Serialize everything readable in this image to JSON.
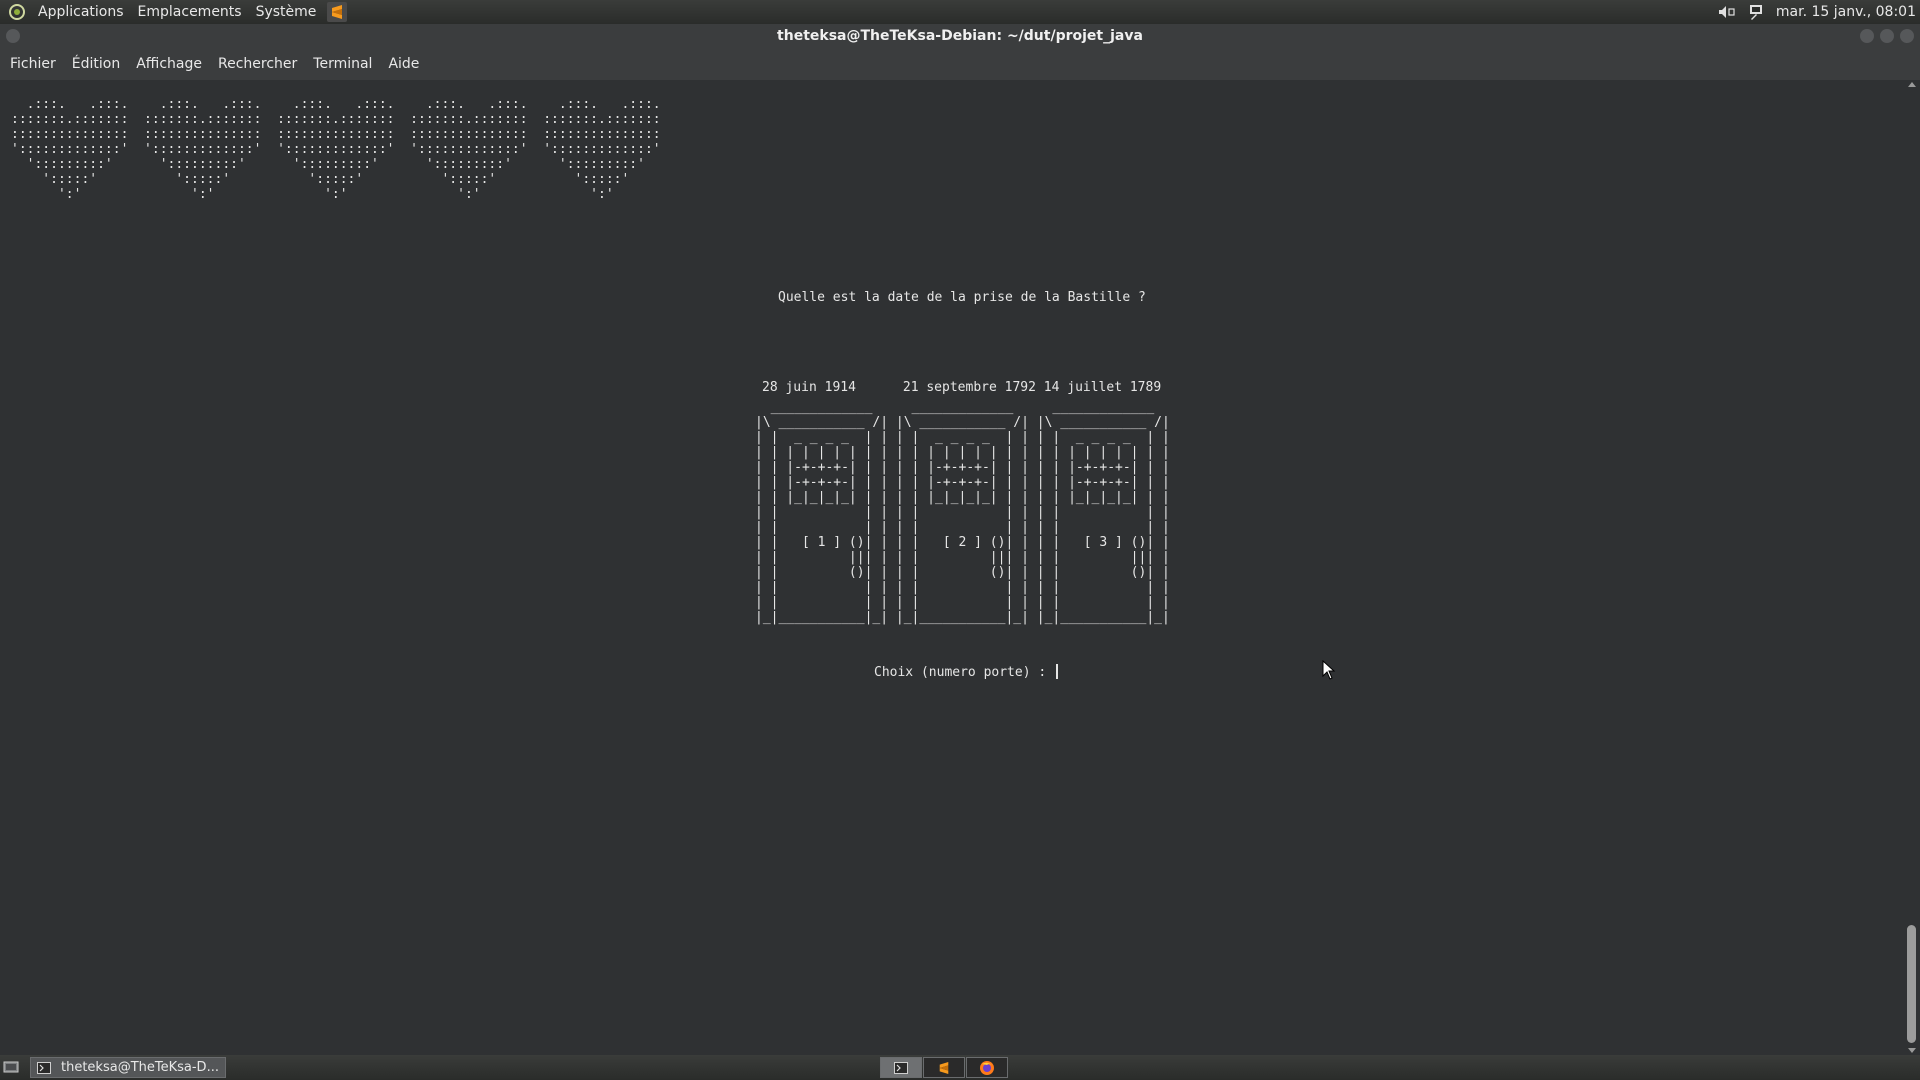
{
  "top_panel": {
    "menus": [
      "Applications",
      "Emplacements",
      "Système"
    ],
    "launcher_icon": "sublime-text-icon",
    "tray": {
      "volume_icon": "volume-icon",
      "network_icon": "network-icon"
    },
    "clock": "mar. 15 janv., 08:01"
  },
  "window": {
    "title": "theteksa@TheTeKsa-Debian: ~/dut/projet_java"
  },
  "menubar": {
    "items": [
      "Fichier",
      "Édition",
      "Affichage",
      "Rechercher",
      "Terminal",
      "Aide"
    ]
  },
  "terminal": {
    "hearts_art": "  .:::.   .:::.    .:::.   .:::.    .:::.   .:::.    .:::.   .:::.    .:::.   .:::.\n:::::::.:::::::  :::::::.:::::::  :::::::.:::::::  :::::::.:::::::  :::::::.:::::::\n:::::::::::::::  :::::::::::::::  :::::::::::::::  :::::::::::::::  :::::::::::::::\n':::::::::::::'  ':::::::::::::'  ':::::::::::::'  ':::::::::::::'  ':::::::::::::'\n  ':::::::::'      ':::::::::'      ':::::::::'      ':::::::::'      ':::::::::'\n    ':::::'          ':::::'          ':::::'          ':::::'          ':::::'\n      ':'              ':'              ':'              ':'              ':'",
    "question": "Quelle est la date de la prise de la Bastille ?",
    "answers_line": "28 juin 1914      21 septembre 1792 14 juillet 1789",
    "doors_art": "  _____________     _____________     _____________\n|\\ ___________ /| |\\ ___________ /| |\\ ___________ /|\n| |  _ _ _ _  | | | |  _ _ _ _  | | | |  _ _ _ _  | |\n| | | | | | | | | | | | | | | | | | | | | | | | | | |\n| | |-+-+-+-| | | | | |-+-+-+-| | | | | |-+-+-+-| | |\n| | |-+-+-+-| | | | | |-+-+-+-| | | | | |-+-+-+-| | |\n| | |_|_|_|_| | | | | |_|_|_|_| | | | | |_|_|_|_| | |\n| |           | | | |           | | | |           | |\n| |           | | | |           | | | |           | |\n| |   [ 1 ] ()| | | |   [ 2 ] ()| | | |   [ 3 ] ()| |\n| |         ||| | | |         ||| | | |         ||| |\n| |         ()| | | |         ()| | | |         ()| |\n| |           | | | |           | | | |           | |\n| |           | | | |           | | | |           | |\n|_|___________|_| |_|___________|_| |_|___________|_|",
    "prompt": "Choix (numero porte) : "
  },
  "bottom_panel": {
    "task_label": "theteksa@TheTeKsa-D...",
    "workspace_icons": [
      "terminal-icon",
      "sublime-text-icon",
      "firefox-icon"
    ]
  }
}
